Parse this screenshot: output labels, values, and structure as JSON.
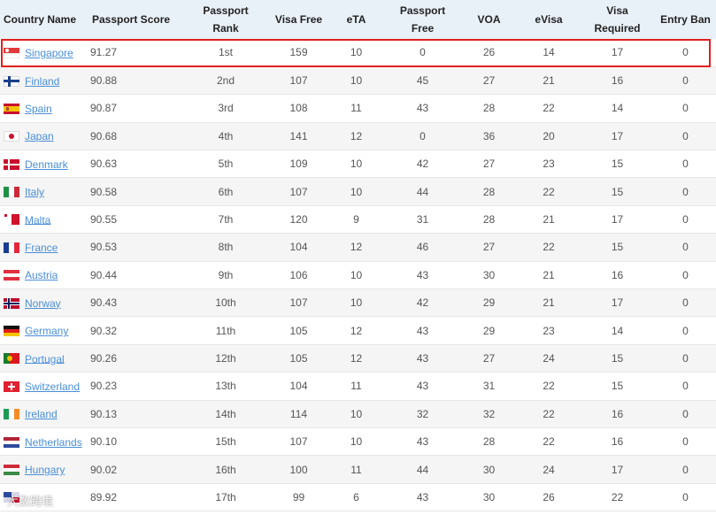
{
  "headers": {
    "country": "Country Name",
    "score": "Passport Score",
    "rank_line1": "Passport",
    "rank_line2": "Rank",
    "visa_free": "Visa Free",
    "eta": "eTA",
    "pf_line1": "Passport",
    "pf_line2": "Free",
    "voa": "VOA",
    "evisa": "eVisa",
    "vr_line1": "Visa",
    "vr_line2": "Required",
    "ban": "Entry Ban"
  },
  "rows": [
    {
      "country": "Singapore",
      "flag": "singapore-flag-icon",
      "score": "91.27",
      "rank": "1st",
      "visa_free": "159",
      "eta": "10",
      "passport_free": "0",
      "voa": "26",
      "evisa": "14",
      "visa_required": "17",
      "entry_ban": "0"
    },
    {
      "country": "Finland",
      "flag": "finland-flag-icon",
      "score": "90.88",
      "rank": "2nd",
      "visa_free": "107",
      "eta": "10",
      "passport_free": "45",
      "voa": "27",
      "evisa": "21",
      "visa_required": "16",
      "entry_ban": "0"
    },
    {
      "country": "Spain",
      "flag": "spain-flag-icon",
      "score": "90.87",
      "rank": "3rd",
      "visa_free": "108",
      "eta": "11",
      "passport_free": "43",
      "voa": "28",
      "evisa": "22",
      "visa_required": "14",
      "entry_ban": "0"
    },
    {
      "country": "Japan",
      "flag": "japan-flag-icon",
      "score": "90.68",
      "rank": "4th",
      "visa_free": "141",
      "eta": "12",
      "passport_free": "0",
      "voa": "36",
      "evisa": "20",
      "visa_required": "17",
      "entry_ban": "0"
    },
    {
      "country": "Denmark",
      "flag": "denmark-flag-icon",
      "score": "90.63",
      "rank": "5th",
      "visa_free": "109",
      "eta": "10",
      "passport_free": "42",
      "voa": "27",
      "evisa": "23",
      "visa_required": "15",
      "entry_ban": "0"
    },
    {
      "country": "Italy",
      "flag": "italy-flag-icon",
      "score": "90.58",
      "rank": "6th",
      "visa_free": "107",
      "eta": "10",
      "passport_free": "44",
      "voa": "28",
      "evisa": "22",
      "visa_required": "15",
      "entry_ban": "0"
    },
    {
      "country": "Malta",
      "flag": "malta-flag-icon",
      "score": "90.55",
      "rank": "7th",
      "visa_free": "120",
      "eta": "9",
      "passport_free": "31",
      "voa": "28",
      "evisa": "21",
      "visa_required": "17",
      "entry_ban": "0"
    },
    {
      "country": "France",
      "flag": "france-flag-icon",
      "score": "90.53",
      "rank": "8th",
      "visa_free": "104",
      "eta": "12",
      "passport_free": "46",
      "voa": "27",
      "evisa": "22",
      "visa_required": "15",
      "entry_ban": "0"
    },
    {
      "country": "Austria",
      "flag": "austria-flag-icon",
      "score": "90.44",
      "rank": "9th",
      "visa_free": "106",
      "eta": "10",
      "passport_free": "43",
      "voa": "30",
      "evisa": "21",
      "visa_required": "16",
      "entry_ban": "0"
    },
    {
      "country": "Norway",
      "flag": "norway-flag-icon",
      "score": "90.43",
      "rank": "10th",
      "visa_free": "107",
      "eta": "10",
      "passport_free": "42",
      "voa": "29",
      "evisa": "21",
      "visa_required": "17",
      "entry_ban": "0"
    },
    {
      "country": "Germany",
      "flag": "germany-flag-icon",
      "score": "90.32",
      "rank": "11th",
      "visa_free": "105",
      "eta": "12",
      "passport_free": "43",
      "voa": "29",
      "evisa": "23",
      "visa_required": "14",
      "entry_ban": "0"
    },
    {
      "country": "Portugal",
      "flag": "portugal-flag-icon",
      "score": "90.26",
      "rank": "12th",
      "visa_free": "105",
      "eta": "12",
      "passport_free": "43",
      "voa": "27",
      "evisa": "24",
      "visa_required": "15",
      "entry_ban": "0"
    },
    {
      "country": "Switzerland",
      "flag": "switzerland-flag-icon",
      "score": "90.23",
      "rank": "13th",
      "visa_free": "104",
      "eta": "11",
      "passport_free": "43",
      "voa": "31",
      "evisa": "22",
      "visa_required": "15",
      "entry_ban": "0"
    },
    {
      "country": "Ireland",
      "flag": "ireland-flag-icon",
      "score": "90.13",
      "rank": "14th",
      "visa_free": "114",
      "eta": "10",
      "passport_free": "32",
      "voa": "32",
      "evisa": "22",
      "visa_required": "16",
      "entry_ban": "0"
    },
    {
      "country": "Netherlands",
      "flag": "netherlands-flag-icon",
      "score": "90.10",
      "rank": "15th",
      "visa_free": "107",
      "eta": "10",
      "passport_free": "43",
      "voa": "28",
      "evisa": "22",
      "visa_required": "16",
      "entry_ban": "0"
    },
    {
      "country": "Hungary",
      "flag": "hungary-flag-icon",
      "score": "90.02",
      "rank": "16th",
      "visa_free": "100",
      "eta": "11",
      "passport_free": "44",
      "voa": "30",
      "evisa": "24",
      "visa_required": "17",
      "entry_ban": "0"
    },
    {
      "country": "",
      "flag": "unknown-flag-icon",
      "score": "89.92",
      "rank": "17th",
      "visa_free": "99",
      "eta": "6",
      "passport_free": "43",
      "voa": "30",
      "evisa": "26",
      "visa_required": "22",
      "entry_ban": "0"
    }
  ],
  "colors": {
    "header_bg": "#e9f1f8",
    "link": "#4a8fd6",
    "highlight": "#e02020",
    "row_alt": "#f5f5f5"
  },
  "watermark": "大数跨境"
}
